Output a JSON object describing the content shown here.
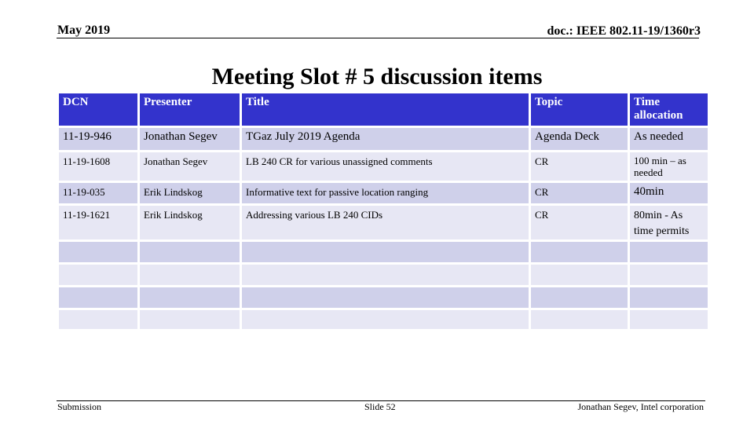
{
  "header": {
    "date": "May 2019",
    "doc_id": "doc.: IEEE 802.11-19/1360r3"
  },
  "slide_title": "Meeting Slot # 5 discussion items",
  "table": {
    "columns": [
      "DCN",
      "Presenter",
      "Title",
      "Topic",
      "Time allocation"
    ],
    "rows": [
      {
        "dcn": "11-19-946",
        "presenter": "Jonathan Segev",
        "title": "TGaz July 2019 Agenda",
        "topic": "Agenda Deck",
        "time": "As needed"
      },
      {
        "dcn": "11-19-1608",
        "presenter": "Jonathan Segev",
        "title": "LB 240 CR for various unassigned comments",
        "topic": "CR",
        "time": "100 min – as needed"
      },
      {
        "dcn": "11-19-035",
        "presenter": "Erik Lindskog",
        "title": "Informative text for passive location ranging",
        "topic": "CR",
        "time": "40min"
      },
      {
        "dcn": "11-19-1621",
        "presenter": "Erik Lindskog",
        "title": "Addressing various LB 240 CIDs",
        "topic": "CR",
        "time": "80min - As time permits"
      },
      {
        "dcn": "",
        "presenter": "",
        "title": "",
        "topic": "",
        "time": ""
      },
      {
        "dcn": "",
        "presenter": "",
        "title": "",
        "topic": "",
        "time": ""
      },
      {
        "dcn": "",
        "presenter": "",
        "title": "",
        "topic": "",
        "time": ""
      },
      {
        "dcn": "",
        "presenter": "",
        "title": "",
        "topic": "",
        "time": ""
      }
    ]
  },
  "colors": {
    "header_bg": "#3333cc",
    "row_odd_bg": "#cfd0ea",
    "row_even_bg": "#e7e7f4"
  },
  "footer": {
    "left": "Submission",
    "center": "Slide 52",
    "right": "Jonathan Segev, Intel corporation"
  }
}
